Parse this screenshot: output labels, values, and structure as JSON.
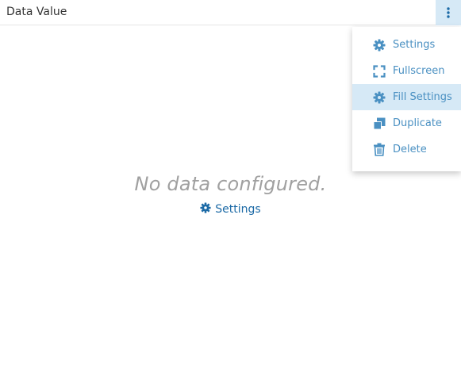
{
  "widget": {
    "title": "Data Value",
    "menu_button_icon": "vertical-ellipsis-icon"
  },
  "menu": {
    "items": [
      {
        "label": "Settings",
        "icon": "gear-icon"
      },
      {
        "label": "Fullscreen",
        "icon": "fullscreen-icon"
      },
      {
        "label": "Fill Settings",
        "icon": "gear-icon",
        "highlighted": true
      },
      {
        "label": "Duplicate",
        "icon": "duplicate-icon"
      },
      {
        "label": "Delete",
        "icon": "trash-icon"
      }
    ]
  },
  "empty_state": {
    "message": "No data configured.",
    "link_label": "Settings",
    "link_icon": "gear-icon"
  },
  "colors": {
    "accent": "#4a90c2",
    "link": "#1c6aa6",
    "highlight": "#d6e9f6",
    "muted_text": "#a0a0a0"
  }
}
